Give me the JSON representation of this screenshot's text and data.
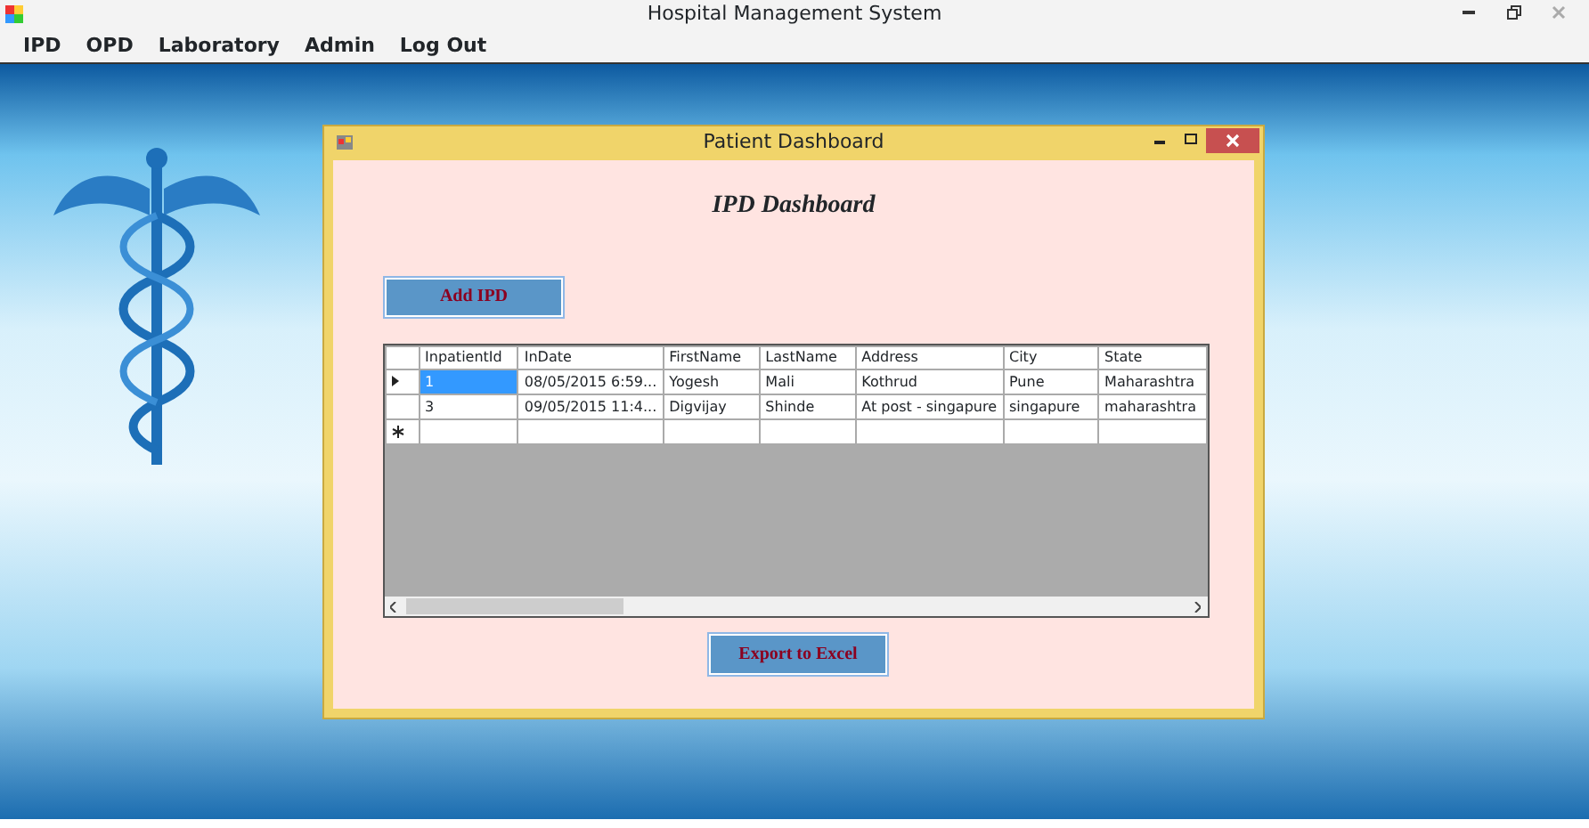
{
  "window": {
    "title": "Hospital Management System"
  },
  "menu": [
    {
      "label": "IPD"
    },
    {
      "label": "OPD"
    },
    {
      "label": "Laboratory"
    },
    {
      "label": "Admin"
    },
    {
      "label": "Log Out"
    }
  ],
  "dialog": {
    "title": "Patient Dashboard",
    "heading": "IPD Dashboard",
    "add_button": "Add IPD",
    "export_button": "Export to Excel"
  },
  "table": {
    "columns": [
      "InpatientId",
      "InDate",
      "FirstName",
      "LastName",
      "Address",
      "City",
      "State"
    ],
    "rows": [
      {
        "selected": true,
        "cells": [
          "1",
          "08/05/2015 6:59...",
          "Yogesh",
          "Mali",
          "Kothrud",
          "Pune",
          "Maharashtra"
        ]
      },
      {
        "selected": false,
        "cells": [
          "3",
          "09/05/2015 11:4...",
          "Digvijay",
          "Shinde",
          "At post - singapure",
          "singapure",
          "maharashtra"
        ]
      }
    ]
  }
}
